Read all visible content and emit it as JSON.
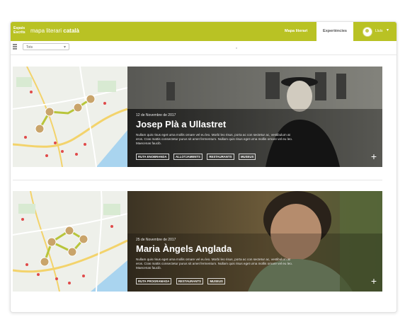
{
  "header": {
    "logo_text": "Espais Escrits",
    "brand_prefix": "mapa literari ",
    "brand_bold": "català",
    "nav_map": "Mapa literari",
    "nav_active_tab": "Experiències",
    "user_name": "Lluís",
    "user_caret": "▾"
  },
  "filter": {
    "select_value": "Tots",
    "select_chevron": "▾"
  },
  "cards": [
    {
      "date": "12 de Novembre de 2017",
      "title": "Josep Plà a Ullastret",
      "description": "Nullam quis risus eget urna mollis ornare vel eu leo. Morbi leo risus, porta ac con sectetur ac, vestibulum at eros. Cras mattis consectetur purus sit amet fermentum. Nullam quis risus eget urna mollis ornare vel eu leo. Maecenas faucib.",
      "tags": [
        "RUTA ENOBRANDA",
        "ALLOTJAMENTS",
        "RESTAURANTS",
        "MUSEUS"
      ],
      "plus": "+"
    },
    {
      "date": "25 de Novembre de 2017",
      "title": "Maria Àngels Anglada",
      "description": "Nullam quis risus eget urna mollis ornare vel eu leo. Morbi leo risus, porta ac con sectetur ac, vestibulum at eros. Cras mattis consectetur purus sit amet fermentum. Nullam quis risus eget urna mollis ornare vel eu leo. Maecenas faucib.",
      "tags": [
        "RUTA PROGRAMADA",
        "RESTAURANTS",
        "MUSEUS"
      ],
      "plus": "+"
    }
  ],
  "colors": {
    "accent": "#b9c224",
    "route": "#b8c53a",
    "water": "#a9d4ef",
    "pin": "#e04a4a"
  }
}
